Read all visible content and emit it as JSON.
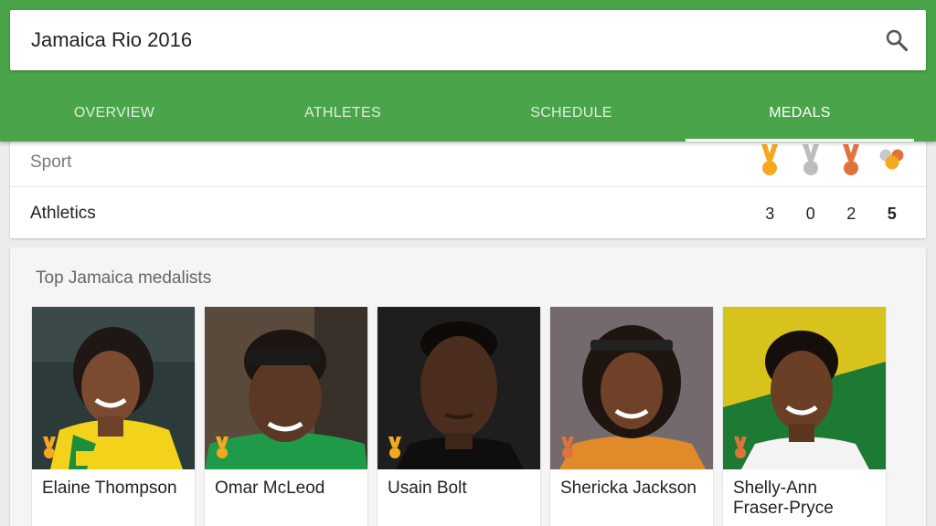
{
  "search": {
    "query": "Jamaica Rio 2016"
  },
  "tabs": [
    {
      "label": "OVERVIEW"
    },
    {
      "label": "ATHLETES"
    },
    {
      "label": "SCHEDULE"
    },
    {
      "label": "MEDALS"
    }
  ],
  "medal_table": {
    "header_label": "Sport",
    "medal_icons": [
      "gold-medal-icon",
      "silver-medal-icon",
      "bronze-medal-icon",
      "total-medals-icon"
    ],
    "rows": [
      {
        "sport": "Athletics",
        "gold": "3",
        "silver": "0",
        "bronze": "2",
        "total": "5"
      }
    ]
  },
  "medalists": {
    "title": "Top Jamaica medalists",
    "athletes": [
      {
        "name": "Elaine Thompson",
        "medal": "gold"
      },
      {
        "name": "Omar McLeod",
        "medal": "gold"
      },
      {
        "name": "Usain Bolt",
        "medal": "gold"
      },
      {
        "name": "Shericka Jackson",
        "medal": "bronze"
      },
      {
        "name": "Shelly-Ann Fraser-Pryce",
        "medal": "bronze"
      }
    ]
  },
  "colors": {
    "header_green": "#4aa54a",
    "gold": "#f4a81d",
    "silver": "#bdbdbd",
    "bronze": "#e0733b"
  }
}
